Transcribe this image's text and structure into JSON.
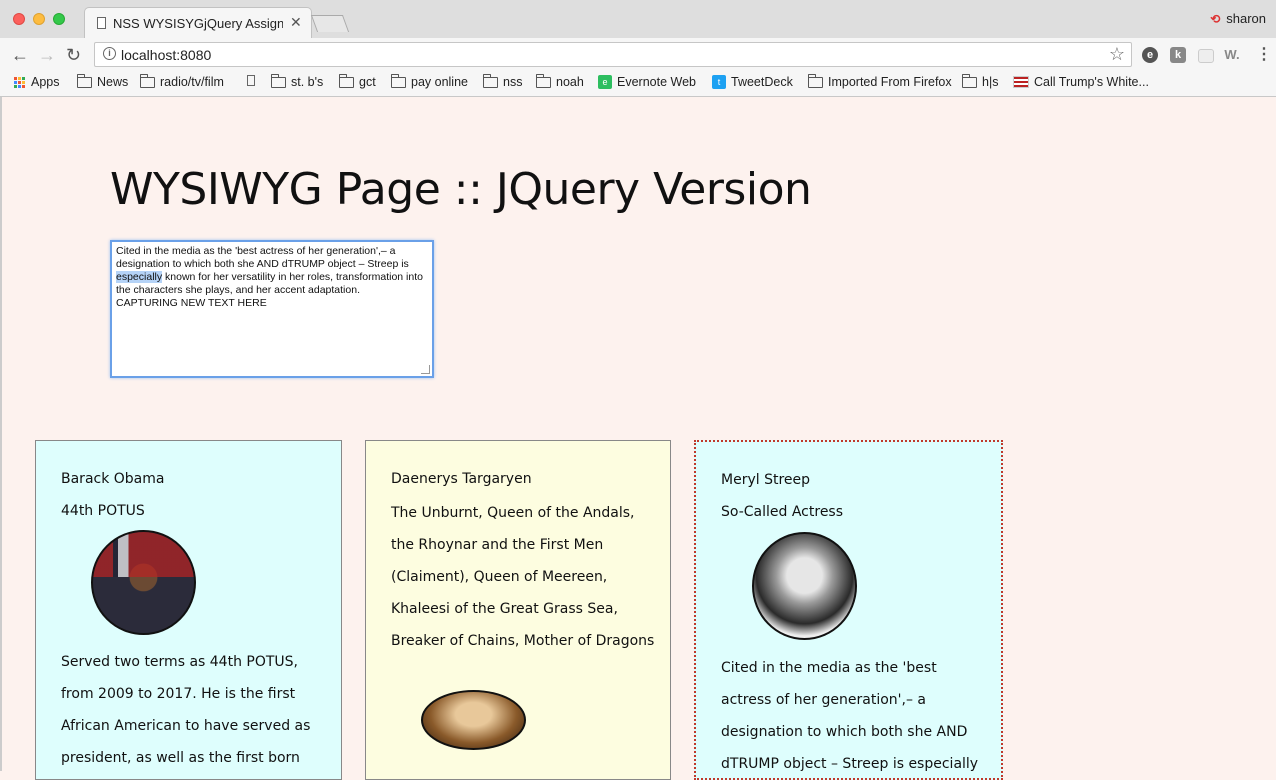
{
  "browser": {
    "tab_title": "NSS WYSISYGjQuery Assignm",
    "url": "localhost:8080",
    "profile_name": "sharon",
    "bookmarks": [
      {
        "label": "Apps",
        "icon": "apps-grid-icon"
      },
      {
        "label": "News",
        "icon": "folder-icon"
      },
      {
        "label": "radio/tv/film",
        "icon": "folder-icon"
      },
      {
        "label": "",
        "icon": "page-icon"
      },
      {
        "label": "st. b's",
        "icon": "folder-icon"
      },
      {
        "label": "gct",
        "icon": "folder-icon"
      },
      {
        "label": "pay online",
        "icon": "folder-icon"
      },
      {
        "label": "nss",
        "icon": "folder-icon"
      },
      {
        "label": "noah",
        "icon": "folder-icon"
      },
      {
        "label": "Evernote Web",
        "icon": "evernote-icon"
      },
      {
        "label": "TweetDeck",
        "icon": "tweetdeck-icon"
      },
      {
        "label": "Imported From Firefox",
        "icon": "folder-icon"
      },
      {
        "label": "h|s",
        "icon": "folder-icon"
      },
      {
        "label": "Call Trump's White...",
        "icon": "flag-icon"
      }
    ]
  },
  "page": {
    "title": "WYSIWYG Page :: JQuery Version",
    "editor": {
      "text_before": "Cited in the media as the 'best actress of her generation',– a designation to which both she AND dTRUMP object – Streep is ",
      "text_selected": "especially",
      "text_after": " known for her versatility in her roles, transformation into the characters she plays, and her accent adaptation.    CAPTURING NEW TEXT HERE"
    },
    "cards": [
      {
        "name": "Barack Obama",
        "title": "44th POTUS",
        "bio": "Served two terms as 44th POTUS, from 2009 to 2017. He is the first African American to have served as president, as well as the first born"
      },
      {
        "name": "Daenerys Targaryen",
        "title": "The Unburnt, Queen of the Andals, the Rhoynar and the First Men (Claiment), Queen of Meereen, Khaleesi of the Great Grass Sea, Breaker of Chains, Mother of Dragons"
      },
      {
        "name": "Meryl Streep",
        "title": "So-Called Actress",
        "bio": "Cited in the media as the 'best actress of her generation',– a designation to which both she AND dTRUMP object – Streep is especially"
      }
    ]
  }
}
